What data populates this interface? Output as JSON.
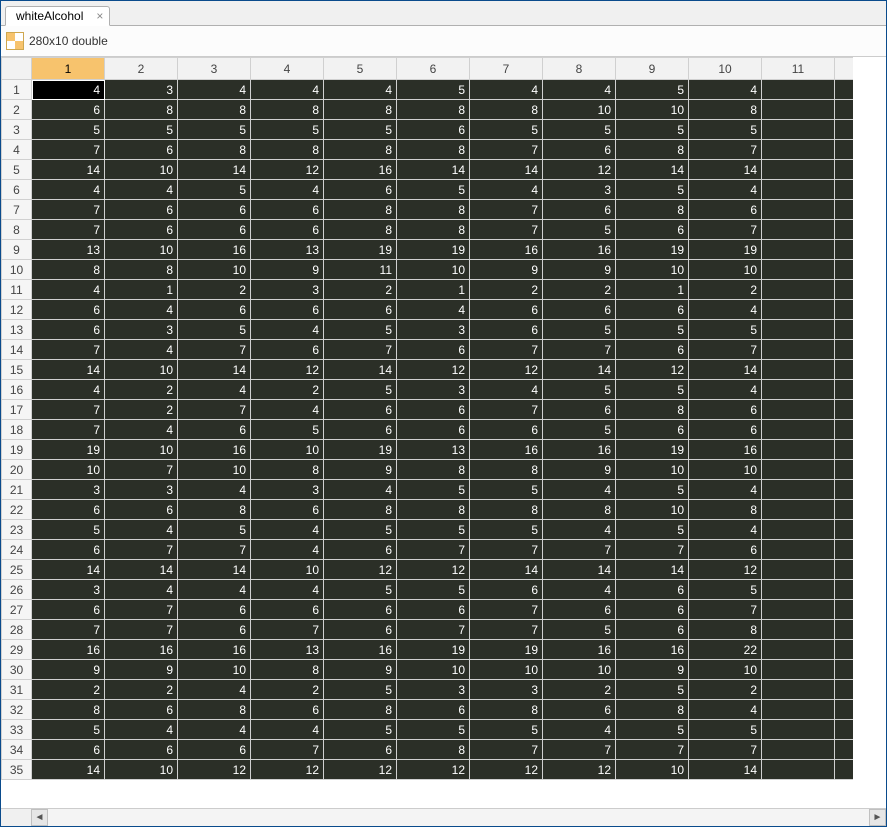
{
  "tab": {
    "title": "whiteAlcohol",
    "close_glyph": "×"
  },
  "typebar": {
    "text": "280x10 double"
  },
  "selection": {
    "active_row": 1,
    "active_col": 1,
    "selected_col": 1
  },
  "columns": {
    "count": 11
  },
  "chart_data": {
    "type": "table",
    "title": "whiteAlcohol",
    "columns": [
      "1",
      "2",
      "3",
      "4",
      "5",
      "6",
      "7",
      "8",
      "9",
      "10"
    ],
    "rows_shown": 35,
    "total_rows": 280,
    "data": [
      [
        4,
        3,
        4,
        4,
        4,
        5,
        4,
        4,
        5,
        4
      ],
      [
        6,
        8,
        8,
        8,
        8,
        8,
        8,
        10,
        10,
        8
      ],
      [
        5,
        5,
        5,
        5,
        5,
        6,
        5,
        5,
        5,
        5
      ],
      [
        7,
        6,
        8,
        8,
        8,
        8,
        7,
        6,
        8,
        7
      ],
      [
        14,
        10,
        14,
        12,
        16,
        14,
        14,
        12,
        14,
        14
      ],
      [
        4,
        4,
        5,
        4,
        6,
        5,
        4,
        3,
        5,
        4
      ],
      [
        7,
        6,
        6,
        6,
        8,
        8,
        7,
        6,
        8,
        6
      ],
      [
        7,
        6,
        6,
        6,
        8,
        8,
        7,
        5,
        6,
        7
      ],
      [
        13,
        10,
        16,
        13,
        19,
        19,
        16,
        16,
        19,
        19
      ],
      [
        8,
        8,
        10,
        9,
        11,
        10,
        9,
        9,
        10,
        10
      ],
      [
        4,
        1,
        2,
        3,
        2,
        1,
        2,
        2,
        1,
        2
      ],
      [
        6,
        4,
        6,
        6,
        6,
        4,
        6,
        6,
        6,
        4
      ],
      [
        6,
        3,
        5,
        4,
        5,
        3,
        6,
        5,
        5,
        5
      ],
      [
        7,
        4,
        7,
        6,
        7,
        6,
        7,
        7,
        6,
        7
      ],
      [
        14,
        10,
        14,
        12,
        14,
        12,
        12,
        14,
        12,
        14
      ],
      [
        4,
        2,
        4,
        2,
        5,
        3,
        4,
        5,
        5,
        4
      ],
      [
        7,
        2,
        7,
        4,
        6,
        6,
        7,
        6,
        8,
        6
      ],
      [
        7,
        4,
        6,
        5,
        6,
        6,
        6,
        5,
        6,
        6
      ],
      [
        19,
        10,
        16,
        10,
        19,
        13,
        16,
        16,
        19,
        16
      ],
      [
        10,
        7,
        10,
        8,
        9,
        8,
        8,
        9,
        10,
        10
      ],
      [
        3,
        3,
        4,
        3,
        4,
        5,
        5,
        4,
        5,
        4
      ],
      [
        6,
        6,
        8,
        6,
        8,
        8,
        8,
        8,
        10,
        8
      ],
      [
        5,
        4,
        5,
        4,
        5,
        5,
        5,
        4,
        5,
        4
      ],
      [
        6,
        7,
        7,
        4,
        6,
        7,
        7,
        7,
        7,
        6
      ],
      [
        14,
        14,
        14,
        10,
        12,
        12,
        14,
        14,
        14,
        12
      ],
      [
        3,
        4,
        4,
        4,
        5,
        5,
        6,
        4,
        6,
        5
      ],
      [
        6,
        7,
        6,
        6,
        6,
        6,
        7,
        6,
        6,
        7
      ],
      [
        7,
        7,
        6,
        7,
        6,
        7,
        7,
        5,
        6,
        8
      ],
      [
        16,
        16,
        16,
        13,
        16,
        19,
        19,
        16,
        16,
        22
      ],
      [
        9,
        9,
        10,
        8,
        9,
        10,
        10,
        10,
        9,
        10
      ],
      [
        2,
        2,
        4,
        2,
        5,
        3,
        3,
        2,
        5,
        2
      ],
      [
        8,
        6,
        8,
        6,
        8,
        6,
        8,
        6,
        8,
        4
      ],
      [
        5,
        4,
        4,
        4,
        5,
        5,
        5,
        4,
        5,
        5
      ],
      [
        6,
        6,
        6,
        7,
        6,
        8,
        7,
        7,
        7,
        7
      ],
      [
        14,
        10,
        12,
        12,
        12,
        12,
        12,
        12,
        10,
        14
      ]
    ]
  }
}
